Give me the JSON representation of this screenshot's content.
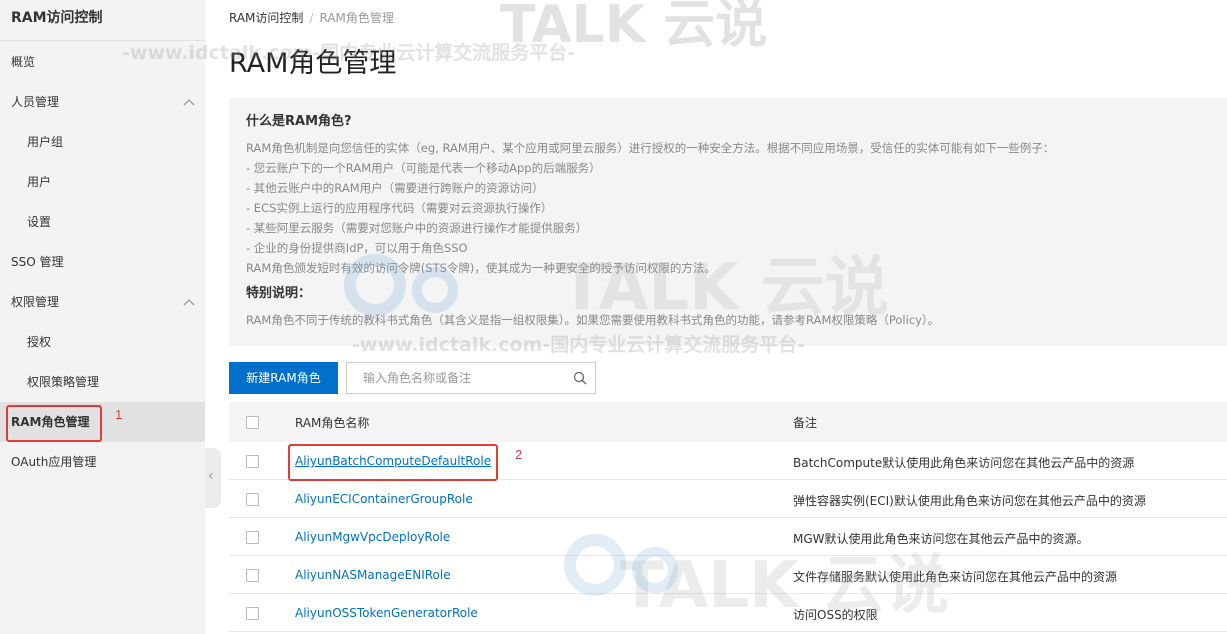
{
  "sidebar": {
    "title": "RAM访问控制",
    "items": [
      {
        "label": "概览"
      },
      {
        "label": "人员管理"
      },
      {
        "label": "用户组"
      },
      {
        "label": "用户"
      },
      {
        "label": "设置"
      },
      {
        "label": "SSO 管理"
      },
      {
        "label": "权限管理"
      },
      {
        "label": "授权"
      },
      {
        "label": "权限策略管理"
      },
      {
        "label": "RAM角色管理"
      },
      {
        "label": "OAuth应用管理"
      }
    ],
    "active_item": "RAM角色管理",
    "annotation": "1"
  },
  "breadcrumb": {
    "root": "RAM访问控制",
    "sep": "/",
    "current": "RAM角色管理"
  },
  "page": {
    "title": "RAM角色管理"
  },
  "info": {
    "heading": "什么是RAM角色?",
    "lines": [
      "RAM角色机制是向您信任的实体（eg, RAM用户、某个应用或阿里云服务）进行授权的一种安全方法。根据不同应用场景，受信任的实体可能有如下一些例子：",
      "- 您云账户下的一个RAM用户（可能是代表一个移动App的后端服务）",
      "- 其他云账户中的RAM用户（需要进行跨账户的资源访问）",
      "- ECS实例上运行的应用程序代码（需要对云资源执行操作）",
      "- 某些阿里云服务（需要对您账户中的资源进行操作才能提供服务）",
      "- 企业的身份提供商IdP，可以用于角色SSO",
      "RAM角色颁发短时有效的访问令牌(STS令牌)，使其成为一种更安全的授予访问权限的方法。"
    ],
    "special_heading": "特别说明：",
    "special_note": "RAM角色不同于传统的教科书式角色（其含义是指一组权限集）。如果您需要使用教科书式角色的功能，请参考RAM权限策略（Policy）。"
  },
  "toolbar": {
    "new_button": "新建RAM角色",
    "search_placeholder": "输入角色名称或备注"
  },
  "table": {
    "col_name": "RAM角色名称",
    "col_note": "备注",
    "rows": [
      {
        "name": "AliyunBatchComputeDefaultRole",
        "note": "BatchCompute默认使用此角色来访问您在其他云产品中的资源"
      },
      {
        "name": "AliyunECIContainerGroupRole",
        "note": "弹性容器实例(ECI)默认使用此角色来访问您在其他云产品中的资源"
      },
      {
        "name": "AliyunMgwVpcDeployRole",
        "note": "MGW默认使用此角色来访问您在其他云产品中的资源。"
      },
      {
        "name": "AliyunNASManageENIRole",
        "note": "文件存储服务默认使用此角色来访问您在其他云产品中的资源"
      },
      {
        "name": "AliyunOSSTokenGeneratorRole",
        "note": "访问OSS的权限"
      }
    ],
    "annotation": "2"
  },
  "watermark": {
    "text": "-www.idctalk.com-国内专业云计算交流服务平台-",
    "brand": "TALK 云说"
  },
  "colors": {
    "accent": "#0070cc",
    "annotation": "#e03c3c",
    "sidebar_bg": "#f3f3f3"
  }
}
